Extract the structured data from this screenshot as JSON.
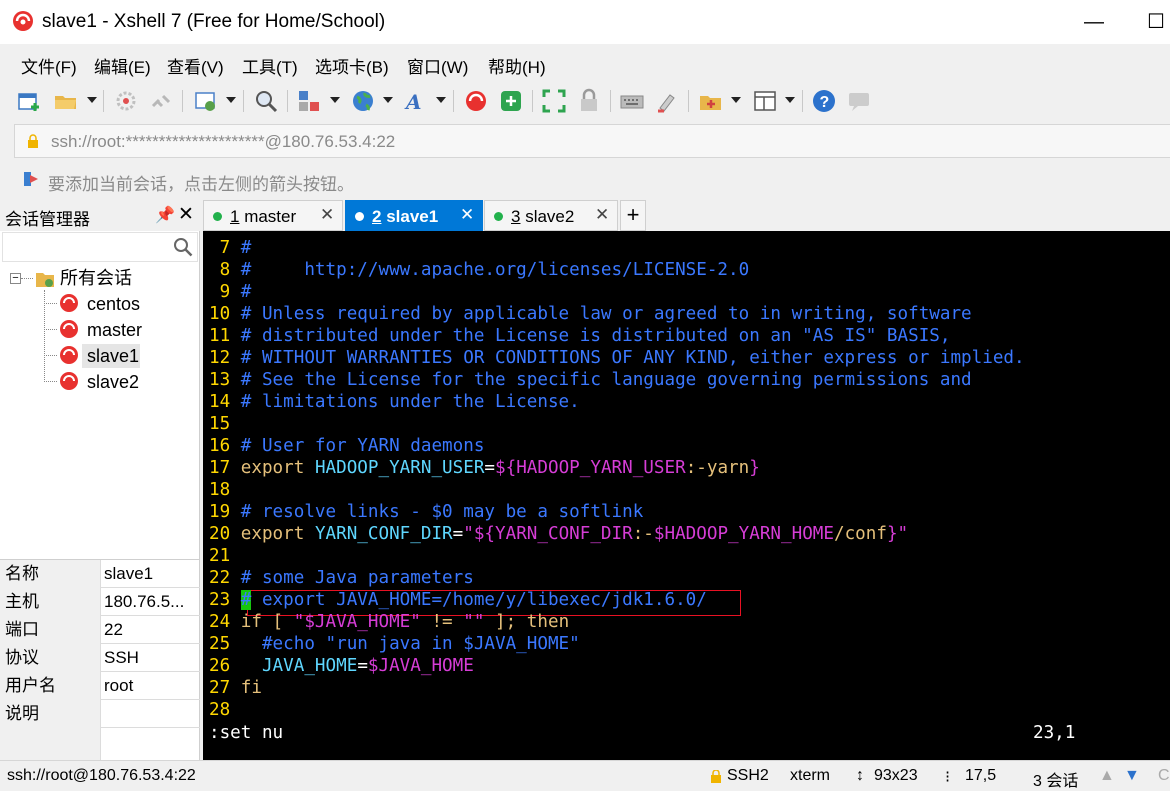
{
  "window": {
    "title": "slave1 - Xshell 7 (Free for Home/School)",
    "minimize": "—",
    "maximize": "☐"
  },
  "menu": [
    "文件(F)",
    "编辑(E)",
    "查看(V)",
    "工具(T)",
    "选项卡(B)",
    "窗口(W)",
    "帮助(H)"
  ],
  "address": {
    "value": "ssh://root:*********************@180.76.53.4:22"
  },
  "hint": "要添加当前会话，点击左侧的箭头按钮。",
  "session_manager": {
    "title": "会话管理器",
    "pin": "📌",
    "close": "✕",
    "search_placeholder": "",
    "root": "所有会话",
    "expander": "−",
    "items": [
      "centos",
      "master",
      "slave1",
      "slave2"
    ],
    "selected": "slave1"
  },
  "properties": [
    {
      "key": "名称",
      "value": "slave1"
    },
    {
      "key": "主机",
      "value": "180.76.5..."
    },
    {
      "key": "端口",
      "value": "22"
    },
    {
      "key": "协议",
      "value": "SSH"
    },
    {
      "key": "用户名",
      "value": "root"
    },
    {
      "key": "说明",
      "value": ""
    }
  ],
  "tabs": [
    {
      "num": "1",
      "label": " master",
      "active": false
    },
    {
      "num": "2",
      "label": " slave1",
      "active": true
    },
    {
      "num": "3",
      "label": " slave2",
      "active": false
    }
  ],
  "tab_close": "✕",
  "tab_add": "+",
  "terminal": {
    "lines": [
      {
        "n": " 7",
        "segs": [
          [
            "cm",
            "#"
          ]
        ]
      },
      {
        "n": " 8",
        "segs": [
          [
            "cm",
            "#     http://www.apache.org/licenses/LICENSE-2.0"
          ]
        ]
      },
      {
        "n": " 9",
        "segs": [
          [
            "cm",
            "#"
          ]
        ]
      },
      {
        "n": "10",
        "segs": [
          [
            "cm",
            "# Unless required by applicable law or agreed to in writing, software"
          ]
        ]
      },
      {
        "n": "11",
        "segs": [
          [
            "cm",
            "# distributed under the License is distributed on an \"AS IS\" BASIS,"
          ]
        ]
      },
      {
        "n": "12",
        "segs": [
          [
            "cm",
            "# WITHOUT WARRANTIES OR CONDITIONS OF ANY KIND, either express or implied."
          ]
        ]
      },
      {
        "n": "13",
        "segs": [
          [
            "cm",
            "# See the License for the specific language governing permissions and"
          ]
        ]
      },
      {
        "n": "14",
        "segs": [
          [
            "cm",
            "# limitations under the License."
          ]
        ]
      },
      {
        "n": "15",
        "segs": []
      },
      {
        "n": "16",
        "segs": [
          [
            "cm",
            "# User for YARN daemons"
          ]
        ]
      },
      {
        "n": "17",
        "segs": [
          [
            "kw",
            "export "
          ],
          [
            "id",
            "HADOOP_YARN_USER"
          ],
          [
            "wt",
            "="
          ],
          [
            "str",
            "${HADOOP_YARN_USER"
          ],
          [
            "kw",
            ":-yarn"
          ],
          [
            "str",
            "}"
          ]
        ]
      },
      {
        "n": "18",
        "segs": []
      },
      {
        "n": "19",
        "segs": [
          [
            "cm",
            "# resolve links - $0 may be a softlink"
          ]
        ]
      },
      {
        "n": "20",
        "segs": [
          [
            "kw",
            "export "
          ],
          [
            "id",
            "YARN_CONF_DIR"
          ],
          [
            "wt",
            "="
          ],
          [
            "str",
            "\"${YARN_CONF_DIR"
          ],
          [
            "kw",
            ":-"
          ],
          [
            "str",
            "$HADOOP_YARN_HOME"
          ],
          [
            "kw",
            "/conf"
          ],
          [
            "str",
            "}\""
          ]
        ]
      },
      {
        "n": "21",
        "segs": []
      },
      {
        "n": "22",
        "segs": [
          [
            "cm",
            "# some Java parameters"
          ]
        ]
      },
      {
        "n": "23",
        "segs": [
          [
            "cur",
            "#"
          ],
          [
            "cm",
            " export JAVA_HOME=/home/y/libexec/jdk1.6.0/"
          ]
        ]
      },
      {
        "n": "24",
        "segs": [
          [
            "kw",
            "if [ "
          ],
          [
            "str",
            "\"$JAVA_HOME\""
          ],
          [
            "kw",
            " != "
          ],
          [
            "str",
            "\"\""
          ],
          [
            "kw",
            " ]; then"
          ]
        ]
      },
      {
        "n": "25",
        "segs": [
          [
            "cm",
            "  #echo \"run java in $JAVA_HOME\""
          ]
        ]
      },
      {
        "n": "26",
        "segs": [
          [
            "id",
            "  JAVA_HOME"
          ],
          [
            "wt",
            "="
          ],
          [
            "str",
            "$JAVA_HOME"
          ]
        ]
      },
      {
        "n": "27",
        "segs": [
          [
            "kw",
            "fi"
          ]
        ]
      },
      {
        "n": "28",
        "segs": []
      }
    ],
    "cmdline": ":set nu",
    "position": "23,1"
  },
  "status": {
    "conn": "ssh://root@180.76.53.4:22",
    "proto": "SSH2",
    "term": "xterm",
    "size": "93x23",
    "cursor": "17,5",
    "sessions": "3 会话",
    "cap": "C"
  }
}
